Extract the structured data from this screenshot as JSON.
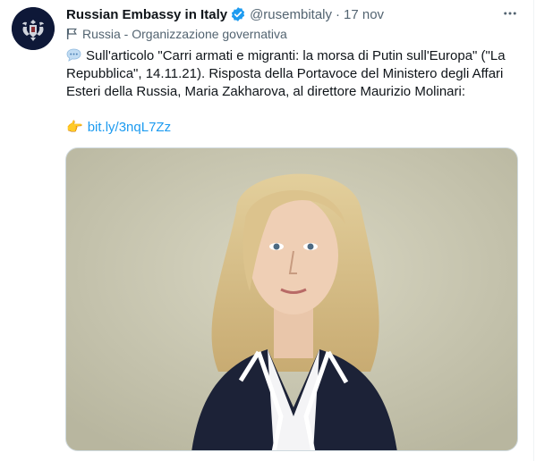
{
  "account": {
    "display_name": "Russian Embassy in Italy",
    "handle": "@rusembitaly",
    "separator": "·",
    "date": "17 nov",
    "affiliation": "Russia - Organizzazione governativa"
  },
  "tweet": {
    "text": "Sull'articolo \"Carri armati e migranti: la morsa di Putin sull'Europa\" (\"La Repubblica\", 14.11.21). Risposta della Portavoce del Ministero degli Affari Esteri della Russia, Maria Zakharova, al direttore Maurizio Molinari:",
    "link": "bit.ly/3nqL7Zz"
  },
  "icons": {
    "verified": "verified-badge-icon",
    "more": "more-options-icon",
    "affiliation": "flag-icon",
    "speech": "speech-bubble-icon",
    "pointer": "pointing-hand-icon"
  },
  "colors": {
    "link": "#1d9bf0",
    "secondary_text": "#536471",
    "verified": "#1d9bf0"
  }
}
